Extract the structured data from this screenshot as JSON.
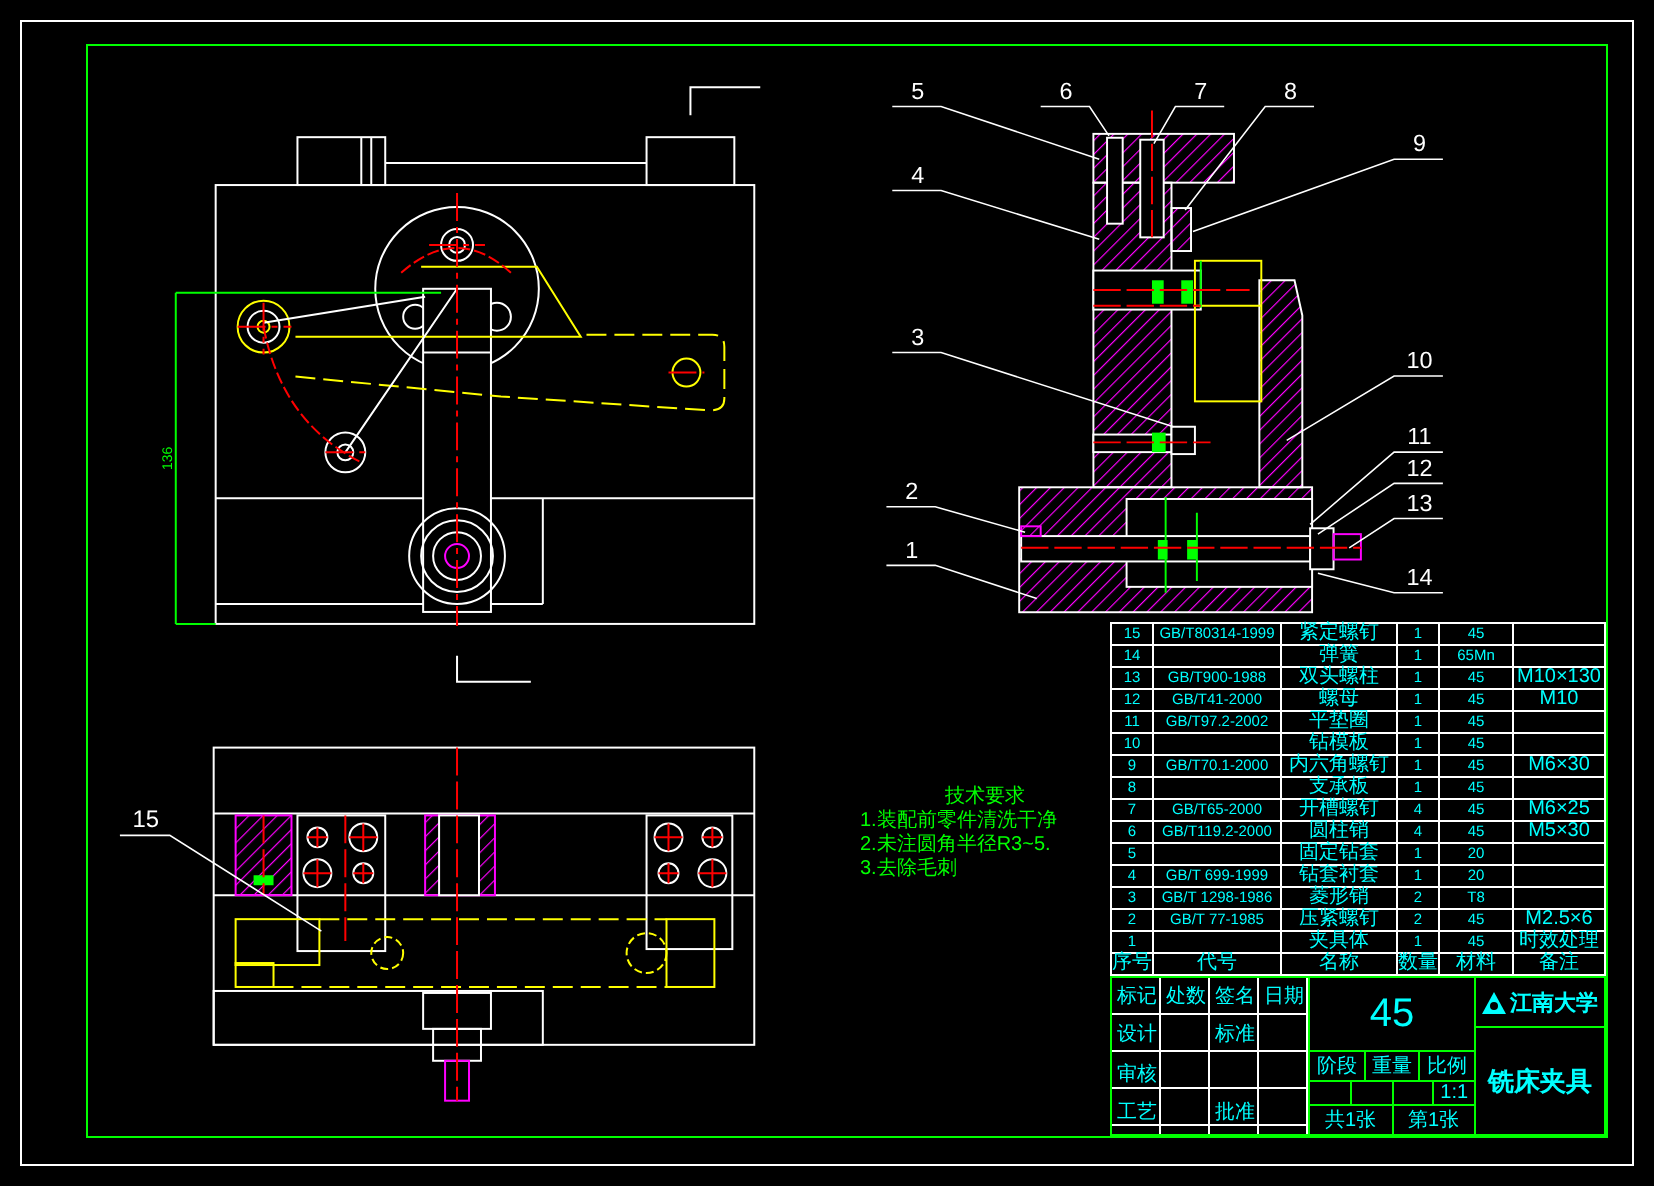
{
  "top_view": {
    "dimension": "136"
  },
  "front_view": {
    "callouts": [
      {
        "label": "15"
      }
    ]
  },
  "section_view": {
    "callouts": [
      {
        "label": "5"
      },
      {
        "label": "6"
      },
      {
        "label": "7"
      },
      {
        "label": "8"
      },
      {
        "label": "9"
      },
      {
        "label": "4"
      },
      {
        "label": "3"
      },
      {
        "label": "10"
      },
      {
        "label": "11"
      },
      {
        "label": "12"
      },
      {
        "label": "13"
      },
      {
        "label": "2"
      },
      {
        "label": "1"
      },
      {
        "label": "14"
      }
    ]
  },
  "notes": {
    "title": "技术要求",
    "lines": [
      "1.装配前零件清洗干净",
      "2.未注圆角半径R3~5.",
      "3.去除毛刺"
    ]
  },
  "parts_list": {
    "rows": [
      {
        "no": "15",
        "code": "GB/T80314-1999",
        "name": "紧定螺钉",
        "qty": "1",
        "material": "45"
      },
      {
        "no": "14",
        "name": "弹簧",
        "qty": "1",
        "material": "65Mn"
      },
      {
        "no": "13",
        "code": "GB/T900-1988",
        "name": "双头螺柱",
        "qty": "1",
        "material": "45",
        "remark": "M10×130"
      },
      {
        "no": "12",
        "code": "GB/T41-2000",
        "name": "螺母",
        "qty": "1",
        "material": "45",
        "remark": "M10"
      },
      {
        "no": "11",
        "code": "GB/T97.2-2002",
        "name": "平垫圈",
        "qty": "1",
        "material": "45"
      },
      {
        "no": "10",
        "name": "钻模板",
        "qty": "1",
        "material": "45"
      },
      {
        "no": "9",
        "code": "GB/T70.1-2000",
        "name": "内六角螺钉",
        "qty": "1",
        "material": "45",
        "remark": "M6×30"
      },
      {
        "no": "8",
        "name": "支承板",
        "qty": "1",
        "material": "45"
      },
      {
        "no": "7",
        "code": "GB/T65-2000",
        "name": "开槽螺钉",
        "qty": "4",
        "material": "45",
        "remark": "M6×25"
      },
      {
        "no": "6",
        "code": "GB/T119.2-2000",
        "name": "圆柱销",
        "qty": "4",
        "material": "45",
        "remark": "M5×30"
      },
      {
        "no": "5",
        "name": "固定钻套",
        "qty": "1",
        "material": "20"
      },
      {
        "no": "4",
        "code": "GB/T 699-1999",
        "name": "钻套衬套",
        "qty": "1",
        "material": "20"
      },
      {
        "no": "3",
        "code": "GB/T 1298-1986",
        "name": "菱形销",
        "qty": "2",
        "material": "T8"
      },
      {
        "no": "2",
        "code": "GB/T 77-1985",
        "name": "压紧螺钉",
        "qty": "2",
        "material": "45",
        "remark": "M2.5×6"
      },
      {
        "no": "1",
        "name": "夹具体",
        "qty": "1",
        "material": "45",
        "remark": "时效处理"
      }
    ],
    "header": [
      "序号",
      "代号",
      "名称",
      "数量",
      "材料",
      "备注"
    ]
  },
  "title_block": {
    "left_labels": [
      "标记",
      "处数",
      "签名",
      "日期",
      "设计",
      "标准",
      "审核",
      "工艺",
      "批准"
    ],
    "material": "45",
    "stage_labels": [
      "阶段",
      "重量",
      "比例"
    ],
    "scale": "1:1",
    "sheets": [
      "共1张",
      "第1张"
    ],
    "school": "江南大学",
    "title": "铣床夹具"
  }
}
